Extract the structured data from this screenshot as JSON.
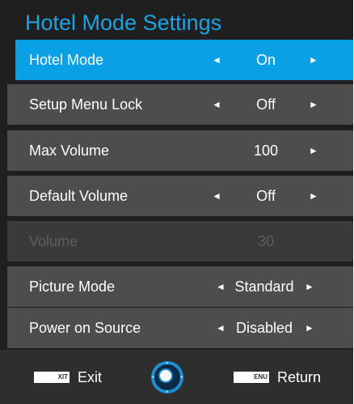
{
  "menu": {
    "title": "Hotel Mode Settings",
    "items": [
      {
        "label": "Hotel Mode",
        "value": "On",
        "left_arrow": "◄",
        "right_arrow": "►"
      },
      {
        "label": "Setup Menu Lock",
        "value": "Off",
        "left_arrow": "◄",
        "right_arrow": "►"
      },
      {
        "label": "Max Volume",
        "value": "100",
        "left_arrow": "",
        "right_arrow": "►"
      },
      {
        "label": "Default Volume",
        "value": "Off",
        "left_arrow": "◄",
        "right_arrow": "►"
      },
      {
        "label": "Volume",
        "value": "30",
        "left_arrow": "",
        "right_arrow": ""
      },
      {
        "label": "Picture Mode",
        "value": "Standard",
        "left_arrow": "◄",
        "right_arrow": "►"
      },
      {
        "label": "Power on Source",
        "value": "Disabled",
        "left_arrow": "◄",
        "right_arrow": "►"
      }
    ]
  },
  "footer": {
    "exit_key": "XIT",
    "exit_label": "Exit",
    "menu_key": "ENU",
    "return_label": "Return"
  },
  "colors": {
    "accent": "#0aa0e6",
    "title": "#1ba3e6",
    "row": "#4d4d4d",
    "background": "#1f1f1f"
  }
}
